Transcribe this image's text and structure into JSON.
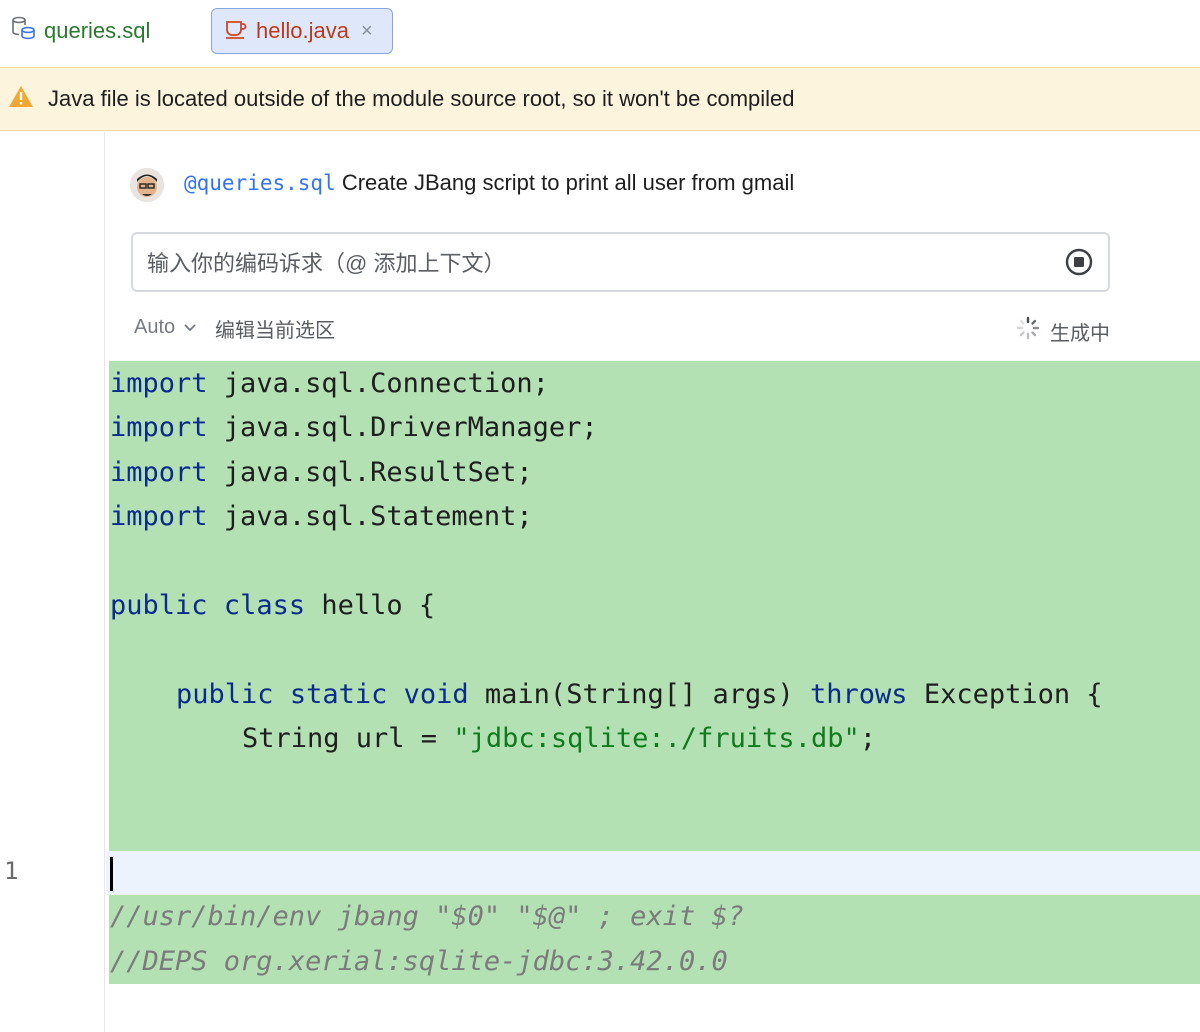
{
  "tabs": [
    {
      "label": "queries.sql",
      "active": false
    },
    {
      "label": "hello.java",
      "active": true,
      "close": "×"
    }
  ],
  "banner": {
    "text": "Java file is located outside of the module source root, so it won't be compiled"
  },
  "prompt": {
    "mention": "@queries.sql",
    "text": " Create JBang script to print all user from gmail"
  },
  "input": {
    "placeholder": "输入你的编码诉求（@ 添加上下文）"
  },
  "toolbar": {
    "mode": "Auto",
    "edit_selection": "编辑当前选区",
    "status": "生成中"
  },
  "gutter": {
    "line_number": "1"
  },
  "code": {
    "lines": [
      {
        "kw": "import",
        "rest": " java.sql.Connection;"
      },
      {
        "kw": "import",
        "rest": " java.sql.DriverManager;"
      },
      {
        "kw": "import",
        "rest": " java.sql.ResultSet;"
      },
      {
        "kw": "import",
        "rest": " java.sql.Statement;"
      }
    ],
    "class_kw1": "public",
    "class_kw2": "class",
    "class_rest": " hello {",
    "main_kw1": "public",
    "main_kw2": "static",
    "main_kw3": "void",
    "main_mid": " main(String[] args) ",
    "main_kw4": "throws",
    "main_rest": " Exception {",
    "url_pre": "String url = ",
    "url_str": "\"jdbc:sqlite:./fruits.db\"",
    "url_post": ";",
    "comment1": "//usr/bin/env jbang \"$0\" \"$@\" ; exit $?",
    "comment2": "//DEPS org.xerial:sqlite-jdbc:3.42.0.0"
  },
  "colors": {
    "accent": "#3574f0",
    "added_code_bg": "#b3e1b3",
    "banner_bg": "#fdf4dd",
    "keyword": "#0a2a8c",
    "string": "#0f7a1e"
  }
}
